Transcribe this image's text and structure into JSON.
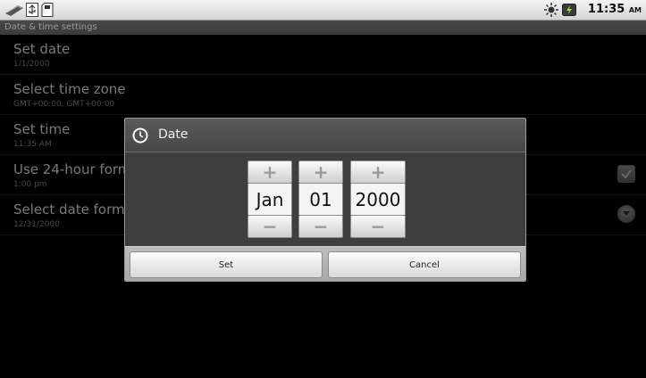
{
  "status_bar": {
    "time": "11:35",
    "ampm": "AM",
    "icons": [
      "usb-debug-icon",
      "usb-icon",
      "sd-card-icon",
      "brightness-icon",
      "battery-icon"
    ]
  },
  "title_bar": {
    "title": "Date & time settings"
  },
  "settings": [
    {
      "title": "Set date",
      "subtitle": "1/1/2000"
    },
    {
      "title": "Select time zone",
      "subtitle": "GMT+00:00, GMT+00:00"
    },
    {
      "title": "Set time",
      "subtitle": "11:35 AM"
    },
    {
      "title": "Use 24-hour format",
      "subtitle": "1:00 pm",
      "widget": "checkbox-icon",
      "checked": true
    },
    {
      "title": "Select date format",
      "subtitle": "12/31/2000",
      "widget": "dropdown-arrow-icon"
    }
  ],
  "dialog": {
    "title": "Date",
    "icon": "clock-icon",
    "pickers": [
      {
        "name": "month",
        "value": "Jan",
        "plus": "+",
        "minus": "−"
      },
      {
        "name": "day",
        "value": "01",
        "plus": "+",
        "minus": "−"
      },
      {
        "name": "year",
        "value": "2000",
        "plus": "+",
        "minus": "−"
      }
    ],
    "set_label": "Set",
    "cancel_label": "Cancel"
  },
  "colors": {
    "background": "#000000",
    "dialog_body": "#3e3e3e",
    "status_bar": "#e8e8e8"
  }
}
